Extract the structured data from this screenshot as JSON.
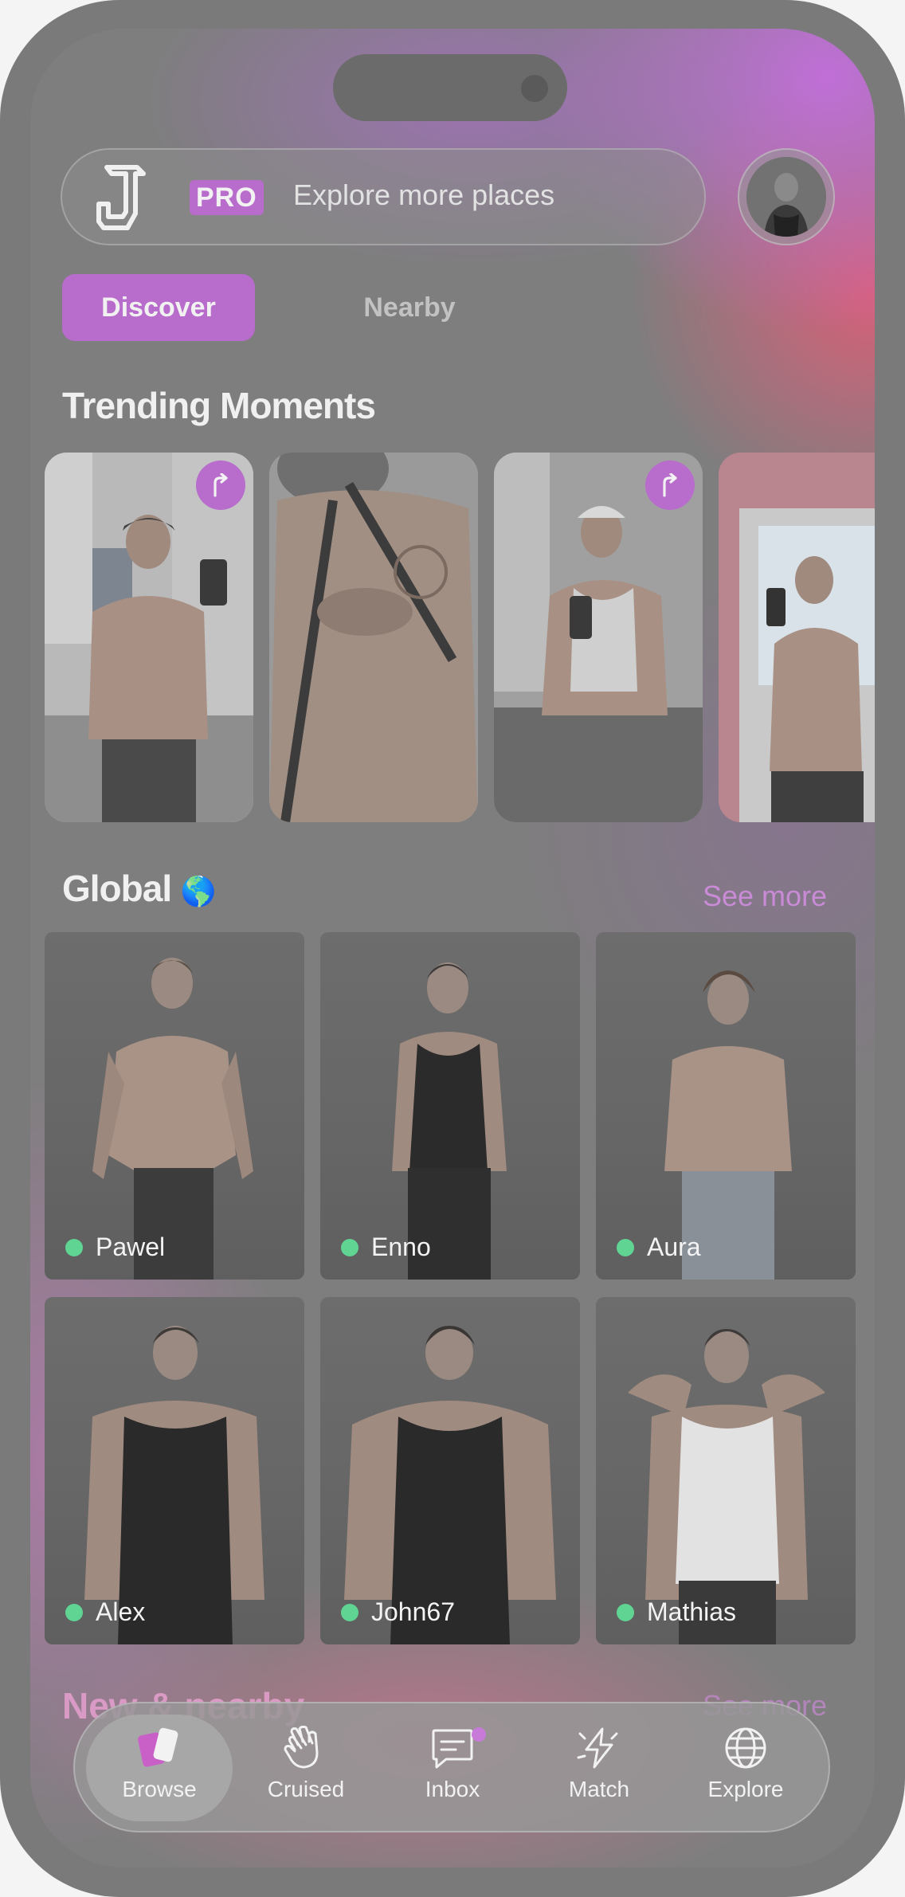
{
  "header": {
    "pro_label": "PRO",
    "search_placeholder": "Explore more places"
  },
  "tabs": {
    "discover": "Discover",
    "nearby": "Nearby"
  },
  "trending": {
    "title": "Trending Moments"
  },
  "global": {
    "title": "Global",
    "globe": "🌎",
    "see_more": "See more",
    "profiles": [
      {
        "name": "Pawel",
        "online": true
      },
      {
        "name": "Enno",
        "online": true
      },
      {
        "name": "Aura",
        "online": true
      },
      {
        "name": "Alex",
        "online": true
      },
      {
        "name": "John67",
        "online": true
      },
      {
        "name": "Mathias",
        "online": true
      }
    ]
  },
  "new_nearby": {
    "title": "New & nearby",
    "see_more": "See more"
  },
  "nav": {
    "items": [
      {
        "label": "Browse",
        "icon": "browse-cards-icon"
      },
      {
        "label": "Cruised",
        "icon": "wave-hand-icon"
      },
      {
        "label": "Inbox",
        "icon": "chat-icon"
      },
      {
        "label": "Match",
        "icon": "lightning-icon"
      },
      {
        "label": "Explore",
        "icon": "globe-icon"
      }
    ]
  },
  "colors": {
    "accent": "#b86ccc",
    "online": "#5fd493"
  }
}
